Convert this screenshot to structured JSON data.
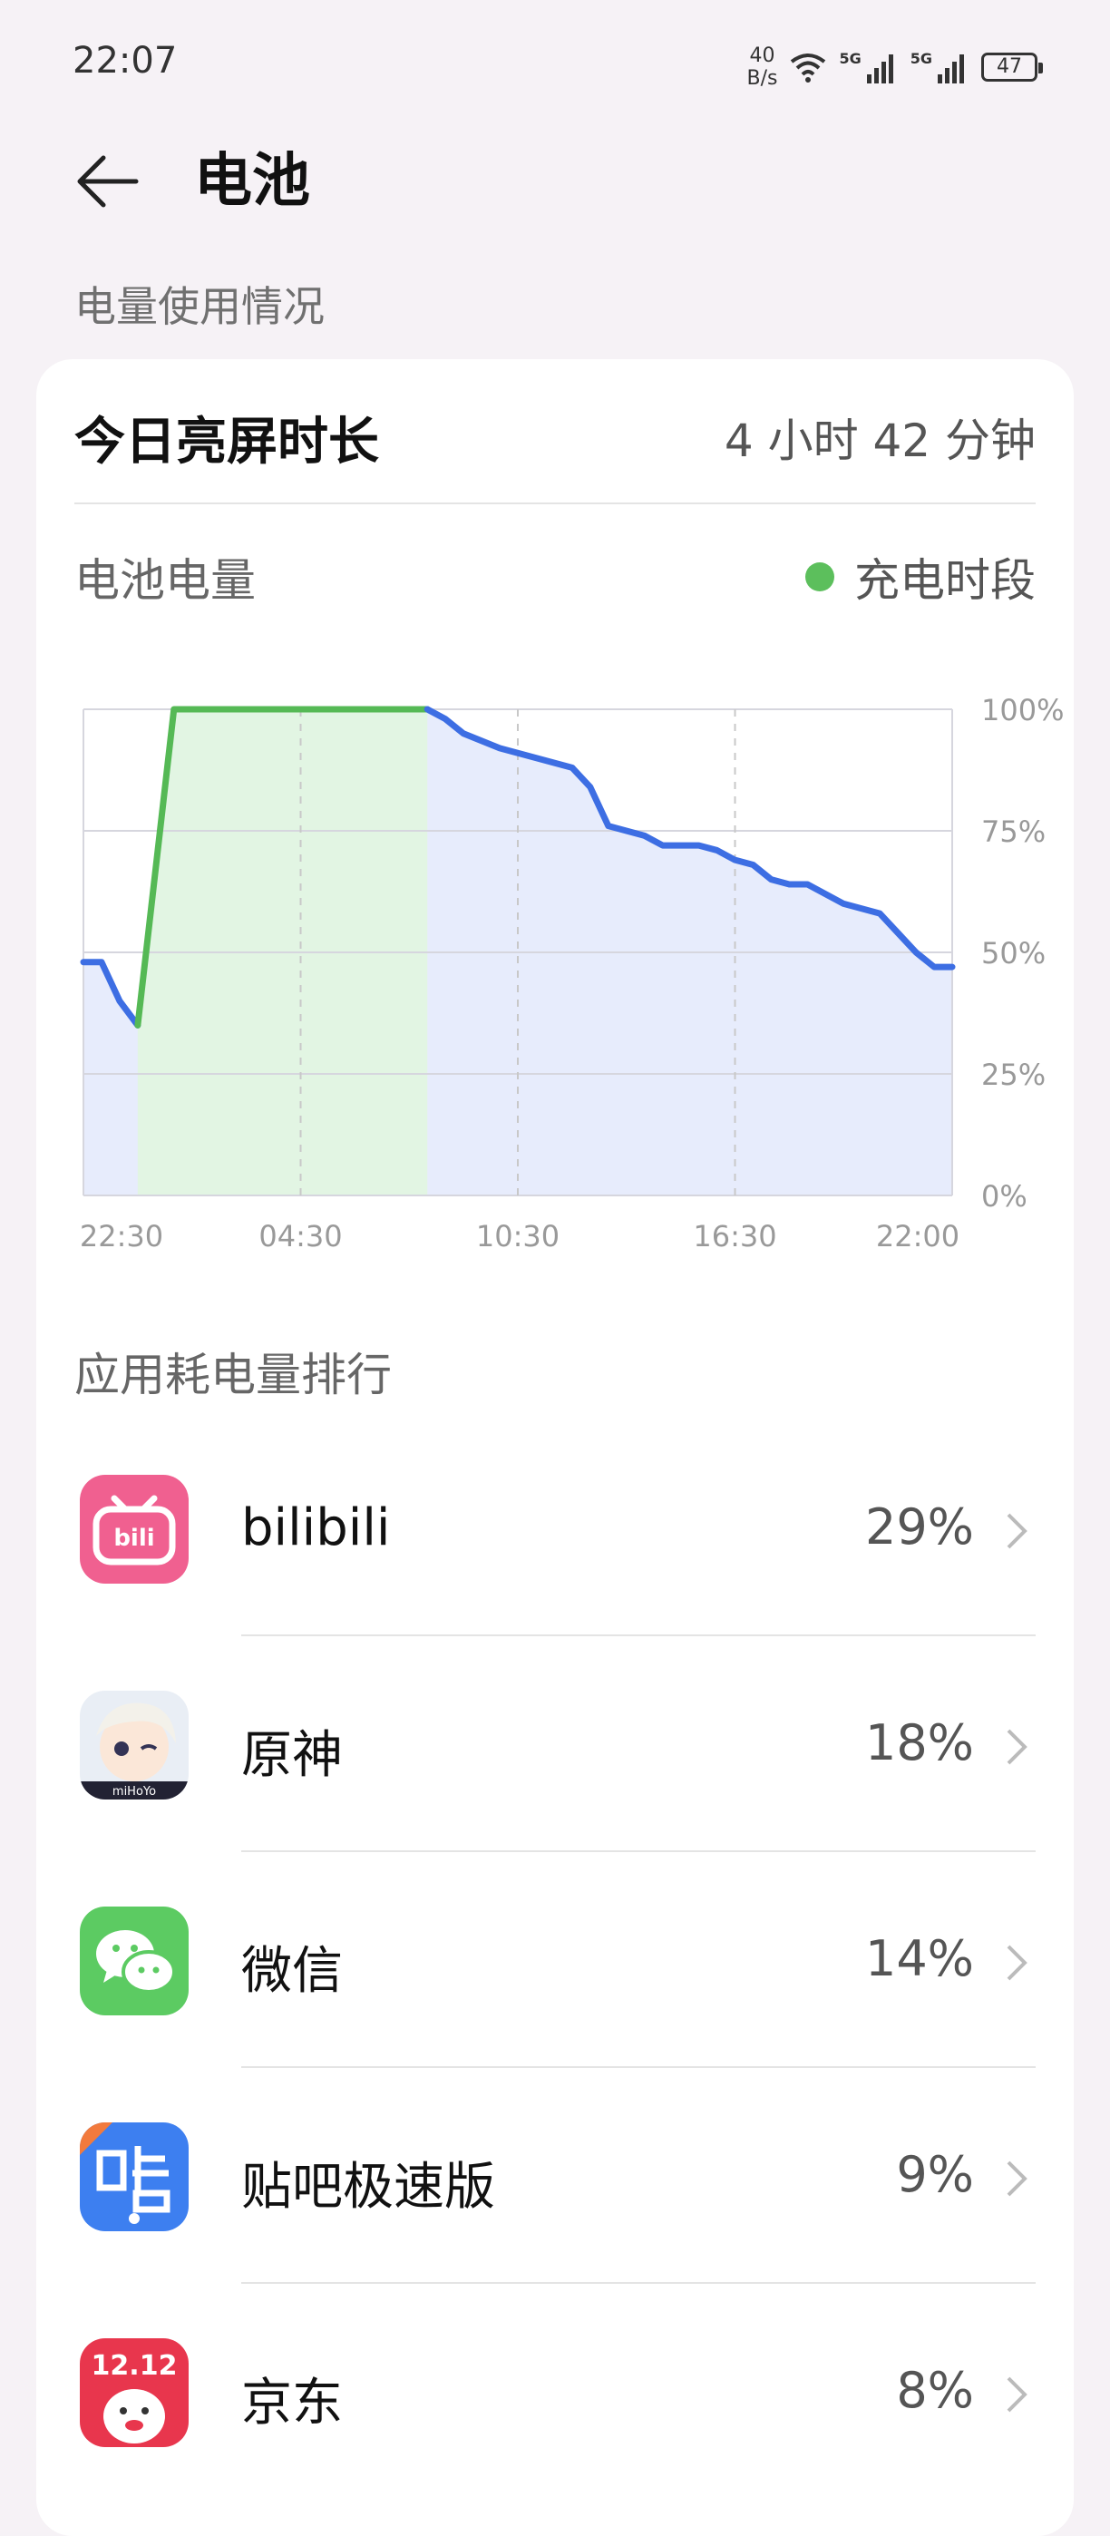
{
  "status_bar": {
    "time": "22:07",
    "net_speed_value": "40",
    "net_speed_unit": "B/s",
    "signal1_label": "5G",
    "signal2_label": "5G",
    "battery_level": "47"
  },
  "header": {
    "title": "电池"
  },
  "usage_section_label": "电量使用情况",
  "screen_time": {
    "label": "今日亮屏时长",
    "value": "4 小时 42 分钟"
  },
  "battery_chart": {
    "label": "电池电量",
    "legend": "充电时段",
    "colors": {
      "line": "#3d6ee3",
      "charging_line": "#55b955",
      "fill": "#e3e9fb",
      "charging_fill": "#e2f5e2"
    }
  },
  "chart_data": {
    "type": "area",
    "x_tick_labels": [
      "22:30",
      "04:30",
      "10:30",
      "16:30",
      "22:00"
    ],
    "y_tick_labels": [
      "100%",
      "75%",
      "50%",
      "25%",
      "0%"
    ],
    "ylim": [
      0,
      100
    ],
    "x_range_hours": [
      0,
      24
    ],
    "series": [
      {
        "points": [
          [
            0,
            48
          ],
          [
            0.5,
            48
          ],
          [
            1,
            40
          ],
          [
            1.5,
            35
          ],
          [
            2.5,
            100
          ],
          [
            9.5,
            100
          ],
          [
            10,
            98
          ],
          [
            10.5,
            95
          ],
          [
            11.5,
            92
          ],
          [
            12.5,
            90
          ],
          [
            13.5,
            88
          ],
          [
            14,
            84
          ],
          [
            14.5,
            76
          ],
          [
            15.5,
            74
          ],
          [
            16,
            72
          ],
          [
            17,
            72
          ],
          [
            17.5,
            71
          ],
          [
            18,
            69
          ],
          [
            18.5,
            68
          ],
          [
            19,
            65
          ],
          [
            19.5,
            64
          ],
          [
            20,
            64
          ],
          [
            21,
            60
          ],
          [
            22,
            58
          ],
          [
            22.5,
            54
          ],
          [
            23,
            50
          ],
          [
            23.5,
            47
          ],
          [
            24,
            47
          ]
        ]
      }
    ],
    "charging_period_hours": [
      1.5,
      9.5
    ]
  },
  "ranking": {
    "title": "应用耗电量排行",
    "apps": [
      {
        "name": "bilibili",
        "percent": "29%",
        "icon": "bilibili-icon",
        "color": "#f06090"
      },
      {
        "name": "原神",
        "percent": "18%",
        "icon": "genshin-icon",
        "color": "#e9eef5"
      },
      {
        "name": "微信",
        "percent": "14%",
        "icon": "wechat-icon",
        "color": "#5ccb62"
      },
      {
        "name": "贴吧极速版",
        "percent": "9%",
        "icon": "tieba-icon",
        "color": "#3d7ff0"
      },
      {
        "name": "京东",
        "percent": "8%",
        "icon": "jd-icon",
        "color": "#e8364d"
      }
    ]
  }
}
